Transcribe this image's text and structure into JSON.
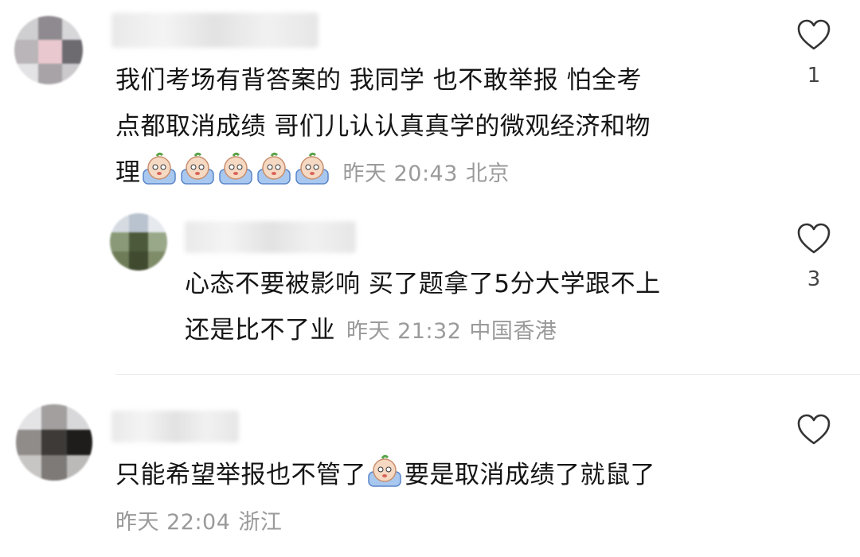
{
  "comments": [
    {
      "line1": "我们考场有背答案的 我同学 也不敢举报 怕全考",
      "line2": "点都取消成绩 哥们儿认认真真学的微观经济和物",
      "line3": "理",
      "time": "昨天 20:43",
      "location": "北京",
      "likes": "1"
    },
    {
      "line1": "心态不要被影响 买了题拿了5分大学跟不上",
      "line2": "还是比不了业",
      "time": "昨天 21:32",
      "location": "中国香港",
      "likes": "3"
    },
    {
      "text_before": "只能希望举报也不管了",
      "text_after": "要是取消成绩了就鼠了",
      "time": "昨天 22:04",
      "location": "浙江",
      "likes": ""
    }
  ],
  "icons": {
    "like": "heart-outline-icon",
    "emoji": "crying-emoji-icon"
  }
}
